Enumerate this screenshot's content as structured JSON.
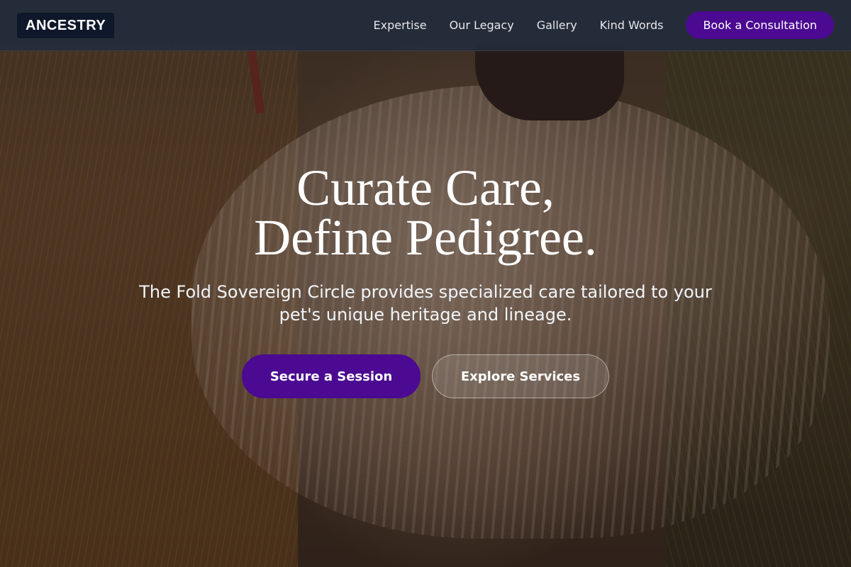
{
  "brand": {
    "logo_text": "ANCESTRY"
  },
  "nav": {
    "links": [
      "Expertise",
      "Our Legacy",
      "Gallery",
      "Kind Words"
    ],
    "cta_label": "Book a Consultation"
  },
  "hero": {
    "headline_line1": "Curate Care,",
    "headline_line2": "Define Pedigree.",
    "subtitle": "The Fold Sovereign Circle provides specialized care tailored to your pet's unique heritage and lineage.",
    "primary_button": "Secure a Session",
    "secondary_button": "Explore Services"
  },
  "colors": {
    "accent": "#4b0a91",
    "navbar": "#242c3c",
    "logo_bg": "#0f172a"
  }
}
